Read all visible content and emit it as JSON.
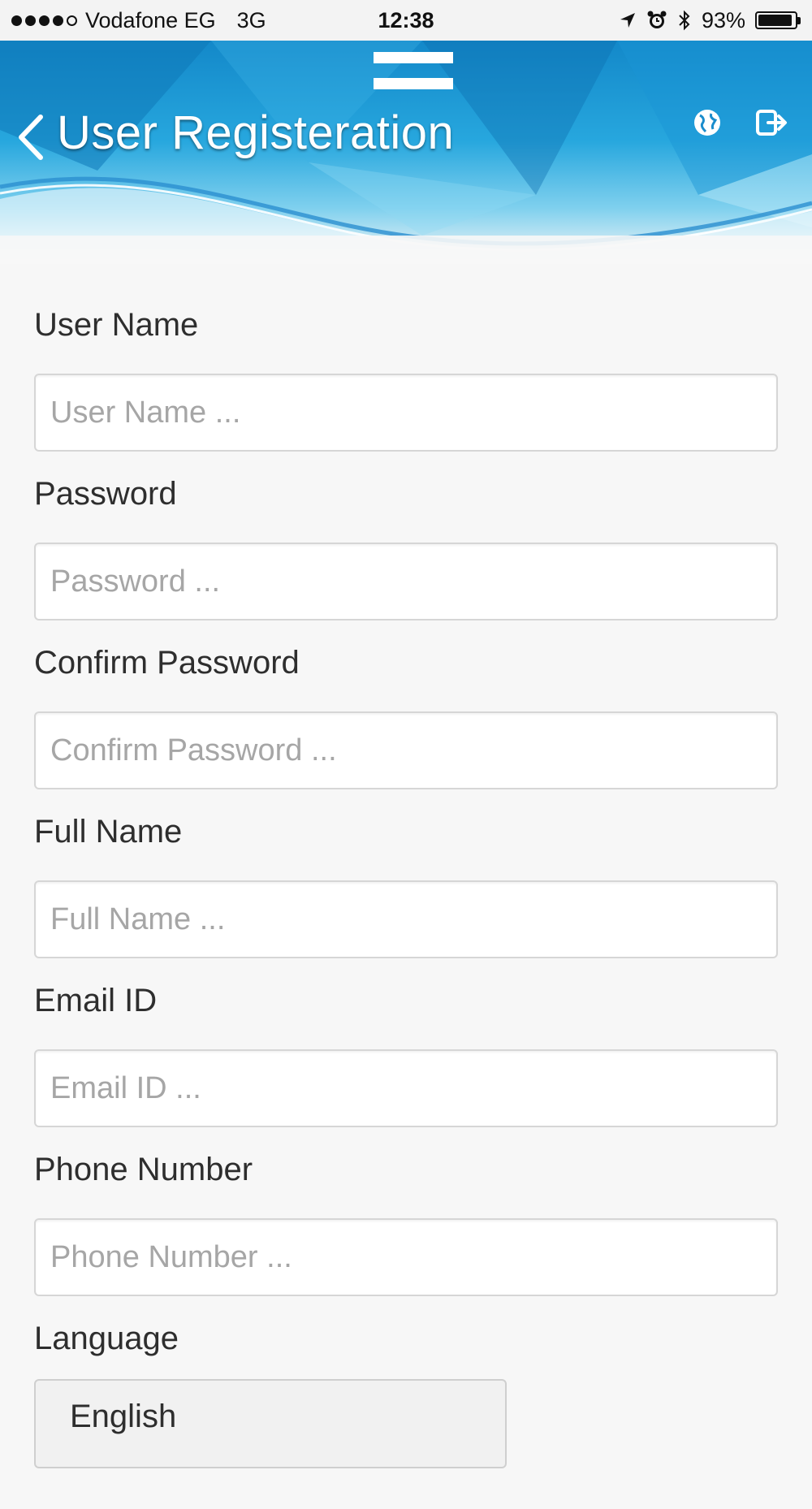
{
  "status_bar": {
    "carrier": "Vodafone EG",
    "network": "3G",
    "time": "12:38",
    "battery": "93%",
    "battery_level": 0.93
  },
  "header": {
    "title": "User Registeration",
    "icons": [
      "menu-icon",
      "back-icon",
      "globe-icon",
      "logout-icon"
    ]
  },
  "form": {
    "username": {
      "label": "User Name",
      "placeholder": "User Name ..."
    },
    "password": {
      "label": "Password",
      "placeholder": "Password ..."
    },
    "confirm_password": {
      "label": "Confirm Password",
      "placeholder": "Confirm Password ..."
    },
    "full_name": {
      "label": "Full Name",
      "placeholder": "Full Name ..."
    },
    "email": {
      "label": "Email ID",
      "placeholder": "Email ID ..."
    },
    "phone": {
      "label": "Phone Number",
      "placeholder": "Phone Number ..."
    },
    "language": {
      "label": "Language",
      "value": "English"
    }
  },
  "colors": {
    "header_blue": "#1388c9",
    "background": "#f7f7f7"
  }
}
